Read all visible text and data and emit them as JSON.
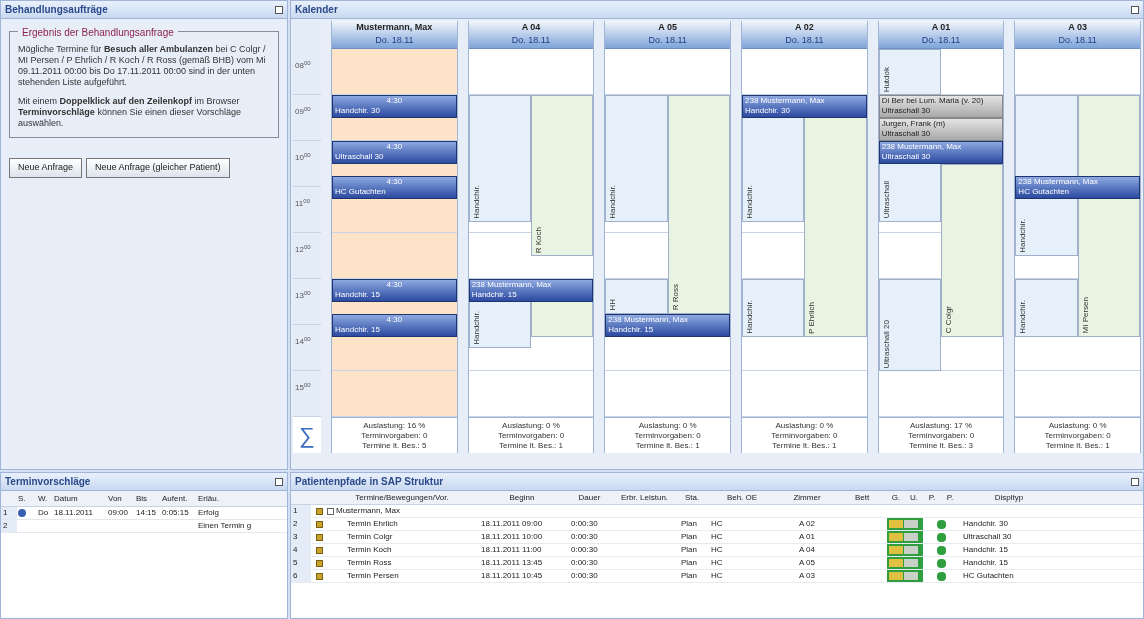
{
  "orders_panel": {
    "title": "Behandlungsaufträge",
    "group_title": "Ergebnis der Behandlungsanfrage",
    "paragraphs": [
      "Mögliche Termine für **Besuch aller Ambulanzen** bei C Colgr / MI Persen / P Ehrlich / R Koch / R Ross (gemäß BHB) vom Mi 09.11.2011 00:00 bis Do 17.11.2011 00:00 sind in der unten stehenden Liste aufgeführt.",
      "Mit einem **Doppelklick auf den Zeilenkopf** im Browser **Terminvorschläge** können Sie einen dieser Vorschläge auswählen."
    ],
    "buttons": [
      "Neue Anfrage",
      "Neue Anfrage (gleicher Patient)"
    ]
  },
  "calendar": {
    "title": "Kalender",
    "sum_symbol": "∑",
    "times": [
      "08$^{00}$",
      "09$^{00}$",
      "10$^{00}$",
      "11$^{00}$",
      "12$^{00}$",
      "13$^{00}$",
      "14$^{00}$",
      "15$^{00}$"
    ],
    "columns": [
      {
        "title": "Mustermann, Max",
        "date": "Do. 18.11",
        "kind": "patient",
        "events": [
          {
            "kind": "blue",
            "lines": [
              "4:30",
              "Handchir. 30"
            ]
          },
          {
            "kind": "blue",
            "lines": [
              "4:30",
              "Ultraschall 30"
            ]
          },
          {
            "kind": "blue",
            "lines": [
              "4:30",
              "HC Gutachten"
            ]
          },
          {
            "kind": "blue",
            "lines": [
              "4:30",
              "Handchir. 15"
            ]
          },
          {
            "kind": "blue",
            "lines": [
              "4:30",
              "Handchir. 15"
            ]
          }
        ],
        "summary": [
          "Auslastung: 16 %",
          "Terminvorgaben: 0",
          "Termine lt. Bes.: 5"
        ]
      },
      {
        "title": "A 04",
        "date": "Do. 18.11",
        "kind": "room",
        "availability": [
          {
            "kind": "treatment",
            "label": "Handchir."
          },
          {
            "kind": "doctor",
            "label": "R Koch"
          },
          {
            "kind": "treatment",
            "label": "Handchir."
          },
          {
            "kind": "doctor"
          }
        ],
        "events": [
          {
            "kind": "blue",
            "lines": [
              "238 Mustermann, Max",
              "Handchir. 15"
            ]
          }
        ],
        "summary": [
          "Auslastung: 0 %",
          "Terminvorgaben: 0",
          "Termine lt. Bes.: 1"
        ]
      },
      {
        "title": "A 05",
        "date": "Do. 18.11",
        "kind": "room",
        "availability": [
          {
            "kind": "treatment",
            "label": "Handchir."
          },
          {
            "kind": "doctor",
            "label": "R Ross"
          },
          {
            "kind": "treatment",
            "label": "HH"
          }
        ],
        "events": [
          {
            "kind": "blue",
            "lines": [
              "238 Mustermann, Max",
              "Handchir. 15"
            ]
          }
        ],
        "summary": [
          "Auslastung: 0 %",
          "Terminvorgaben: 0",
          "Termine lt. Bes.: 1"
        ]
      },
      {
        "title": "A 02",
        "date": "Do. 18.11",
        "kind": "room",
        "availability": [
          {
            "kind": "treatment",
            "label": "Handchir."
          },
          {
            "kind": "doctor",
            "label": "P Ehrlich"
          },
          {
            "kind": "treatment",
            "label": "Handchir."
          }
        ],
        "events": [
          {
            "kind": "blue",
            "lines": [
              "238 Mustermann, Max",
              "Handchir. 30"
            ]
          }
        ],
        "summary": [
          "Auslastung: 0 %",
          "Terminvorgaben: 0",
          "Termine lt. Bes.: 1"
        ]
      },
      {
        "title": "A 01",
        "date": "Do. 18.11",
        "kind": "room",
        "availability": [
          {
            "kind": "treatment",
            "label": "Hutdok"
          },
          {
            "kind": "treatment",
            "label": "Ultraschall"
          },
          {
            "kind": "doctor",
            "label": "C Colgr"
          },
          {
            "kind": "treatment",
            "label": "Ultraschall 20"
          }
        ],
        "events": [
          {
            "kind": "grey",
            "lines": [
              "Di Ber bei Lum. Maria (v. 20)",
              "Ultraschall 30"
            ]
          },
          {
            "kind": "grey",
            "lines": [
              "Jurgen, Frank (m)",
              "Ultraschall 30"
            ]
          },
          {
            "kind": "blue",
            "lines": [
              "238 Mustermann, Max",
              "Ultraschall 30"
            ]
          }
        ],
        "summary": [
          "Auslastung: 17 %",
          "Terminvorgaben: 0",
          "Termine lt. Bes.: 3"
        ]
      },
      {
        "title": "A 03",
        "date": "Do. 18.11",
        "kind": "room",
        "availability": [
          {
            "kind": "treatment",
            "label": "Handchir."
          },
          {
            "kind": "doctor",
            "label": "MI Persen"
          },
          {
            "kind": "treatment",
            "label": "Handchir."
          }
        ],
        "events": [
          {
            "kind": "blue",
            "lines": [
              "238 Mustermann, Max",
              "HC Gutachten"
            ]
          }
        ],
        "summary": [
          "Auslastung: 0 %",
          "Terminvorgaben: 0",
          "Termine lt. Bes.: 1"
        ]
      }
    ]
  },
  "proposals": {
    "title": "Terminvorschläge",
    "columns": [
      "S.",
      "W.",
      "Datum",
      "Von",
      "Bis",
      "Aufent.",
      "Erläu."
    ],
    "rows": [
      {
        "number": "1",
        "color": "#3b5fb0",
        "cells": [
          "",
          "Do",
          "18.11.2011",
          "09:00",
          "14:15",
          "0:05:15",
          "Erfolg"
        ]
      },
      {
        "number": "2",
        "cells": [
          "",
          "",
          "",
          "",
          "",
          "",
          "Einen Termin g"
        ]
      }
    ]
  },
  "pathways": {
    "title": "Patientenpfade in SAP Struktur",
    "columns": [
      "Termine/Bewegungen/Vor.",
      "Beginn",
      "Dauer",
      "Erbr. Leistun.",
      "Sta.",
      "Beh. OE",
      "Zimmer",
      "Bett",
      "G.",
      "U.",
      "P.",
      "P.",
      "Displtyp"
    ],
    "rows": [
      {
        "number": "1",
        "kind": "patient",
        "name": "Mustermann, Max",
        "expanded": true
      },
      {
        "number": "2",
        "kind": "appointment",
        "name": "Termin Ehrlich",
        "begin": "18.11.2011 09:00",
        "duration": "0:00:30",
        "status": "Plan",
        "unit": "HC",
        "room": "A 02",
        "display": "Handchir. 30"
      },
      {
        "number": "3",
        "kind": "appointment",
        "name": "Termin Colgr",
        "begin": "18.11.2011 10:00",
        "duration": "0:00:30",
        "status": "Plan",
        "unit": "HC",
        "room": "A 01",
        "display": "Ultraschall 30"
      },
      {
        "number": "4",
        "kind": "appointment",
        "name": "Termin Koch",
        "begin": "18.11.2011 11:00",
        "duration": "0:00:30",
        "status": "Plan",
        "unit": "HC",
        "room": "A 04",
        "display": "Handchir. 15"
      },
      {
        "number": "5",
        "kind": "appointment",
        "name": "Termin Ross",
        "begin": "18.11.2011 13:45",
        "duration": "0:00:30",
        "status": "Plan",
        "unit": "HC",
        "room": "A 05",
        "display": "Handchir. 15"
      },
      {
        "number": "6",
        "kind": "appointment",
        "name": "Termin Persen",
        "begin": "18.11.2011 10:45",
        "duration": "0:00:30",
        "status": "Plan",
        "unit": "HC",
        "room": "A 03",
        "display": "HC Gutachten"
      }
    ]
  }
}
